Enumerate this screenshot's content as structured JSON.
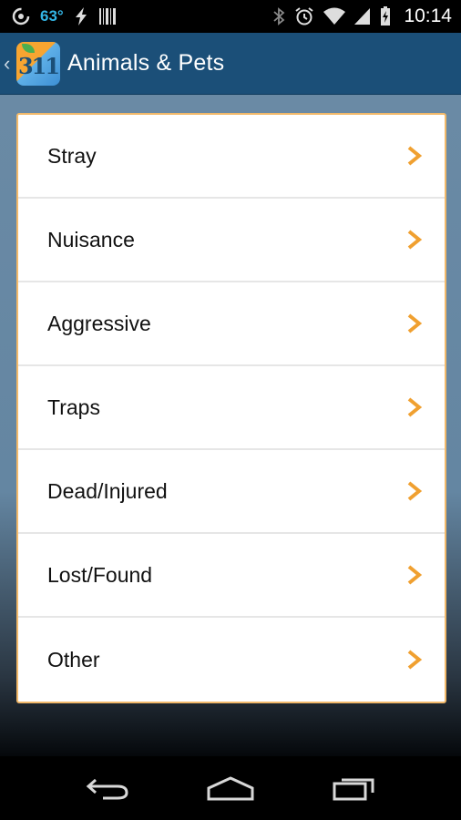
{
  "status_bar": {
    "temperature": "63°",
    "time": "10:14"
  },
  "action_bar": {
    "title": "Animals & Pets",
    "logo_text": "311"
  },
  "menu": {
    "items": [
      {
        "label": "Stray"
      },
      {
        "label": "Nuisance"
      },
      {
        "label": "Aggressive"
      },
      {
        "label": "Traps"
      },
      {
        "label": "Dead/Injured"
      },
      {
        "label": "Lost/Found"
      },
      {
        "label": "Other"
      }
    ]
  },
  "colors": {
    "action_bar": "#1b4f78",
    "accent_chevron": "#f0a030",
    "card_border": "#f2b96a",
    "background": "#6a8aa5"
  },
  "icons": {
    "status_left": [
      "app-notification-icon",
      "lightning-icon",
      "barcode-icon"
    ],
    "status_right": [
      "bluetooth-icon",
      "alarm-icon",
      "wifi-icon",
      "signal-icon",
      "battery-icon"
    ],
    "nav": [
      "back-icon",
      "home-icon",
      "recent-apps-icon"
    ]
  }
}
